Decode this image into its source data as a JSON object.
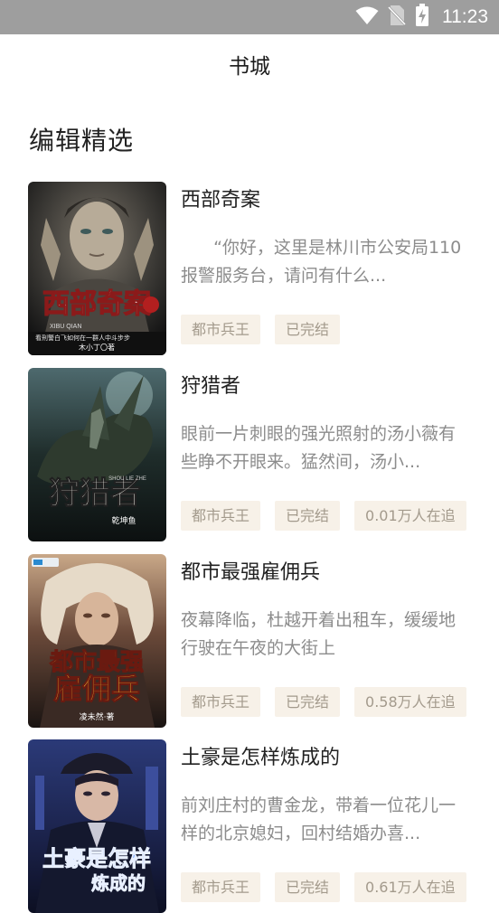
{
  "status_bar": {
    "time": "11:23",
    "icons": [
      "wifi-icon",
      "no-sim-icon",
      "battery-charging-icon"
    ]
  },
  "header": {
    "title": "书城"
  },
  "section": {
    "title": "编辑精选"
  },
  "books": [
    {
      "title": "西部奇案",
      "description": "“你好，这里是林川市公安局110报警服务台，请问有什么...",
      "tags": [
        "都市兵王",
        "已完结"
      ],
      "cover_title": "西部奇案",
      "cover_pinyin": "XIBU QIAN",
      "cover_author": "木小丁〇著",
      "cover_tagline": "看刑警白飞如何在一群人中斗步步"
    },
    {
      "title": "狩猎者",
      "description": "眼前一片刺眼的强光照射的汤小薇有些睁不开眼来。猛然间，汤小...",
      "tags": [
        "都市兵王",
        "已完结",
        "0.01万人在追"
      ],
      "cover_title": "狩猎者",
      "cover_pinyin": "SHOU LIE ZHE",
      "cover_author": "乾坤鱼"
    },
    {
      "title": "都市最强雇佣兵",
      "description": "夜幕降临，杜越开着出租车，缓缓地行驶在午夜的大街上",
      "tags": [
        "都市兵王",
        "已完结",
        "0.58万人在追"
      ],
      "cover_title_line1": "都市最强",
      "cover_title_line2": "雇佣兵",
      "cover_author": "凌未然·著"
    },
    {
      "title": "土豪是怎样炼成的",
      "description": "前刘庄村的曹金龙，带着一位花儿一样的北京媳妇，回村结婚办喜...",
      "tags": [
        "都市兵王",
        "已完结",
        "0.61万人在追"
      ],
      "cover_title_line1": "土豪是怎样",
      "cover_title_line2": "炼成的"
    }
  ]
}
